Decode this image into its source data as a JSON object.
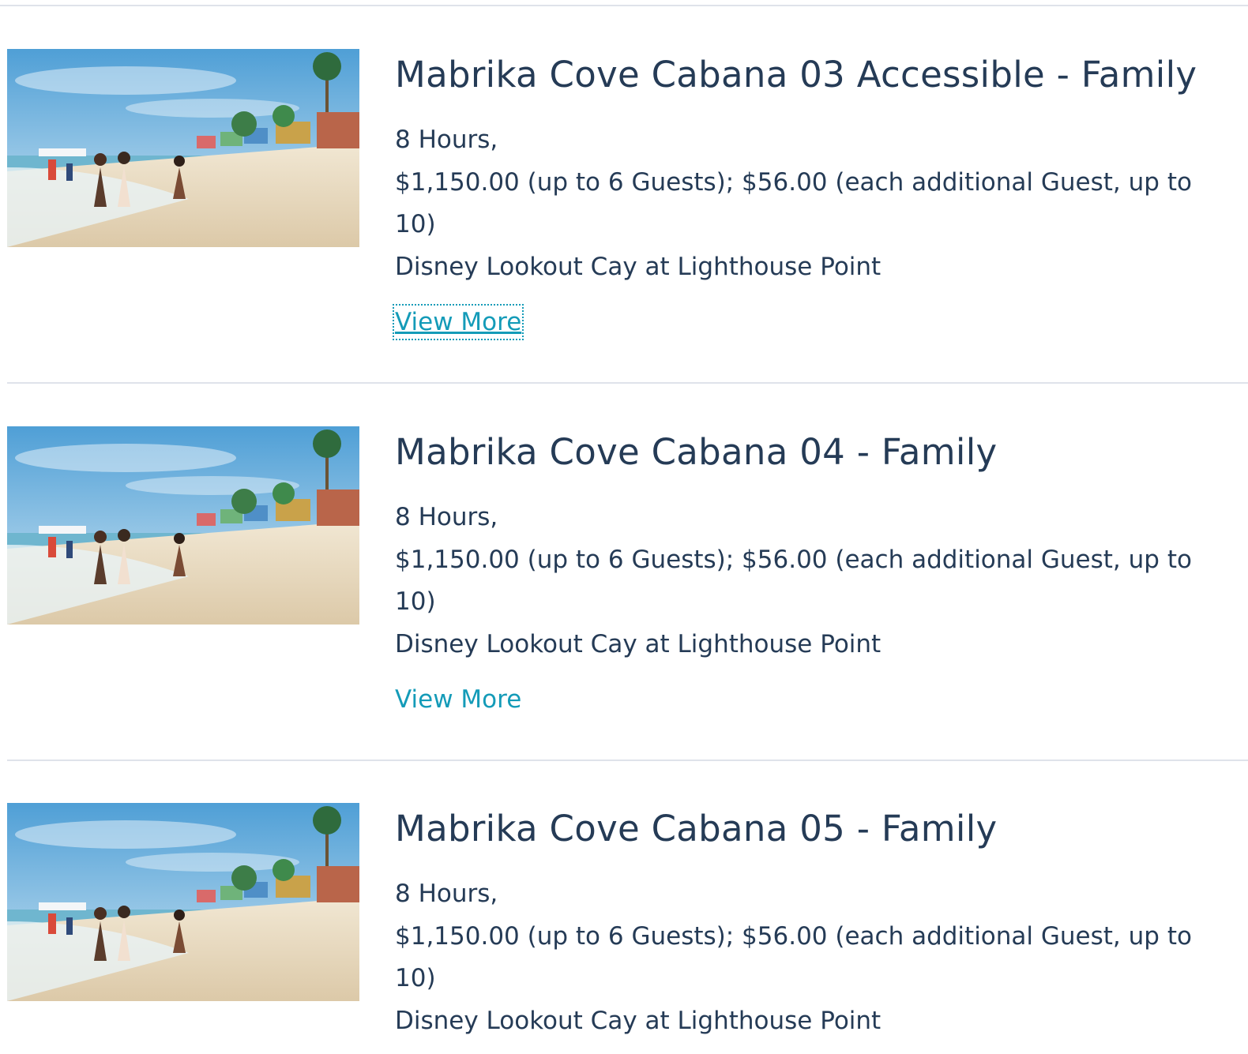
{
  "colors": {
    "title": "#253b56",
    "body_text": "#253b56",
    "link": "#149bb8",
    "divider": "#dfe3ea"
  },
  "cards": [
    {
      "image_icon": "beach-scene-image",
      "title": "Mabrika Cove Cabana 03 Accessible - Family",
      "duration": "8 Hours,",
      "price": "$1,150.00 (up to 6 Guests); $56.00 (each additional Guest, up to 10)",
      "location": "Disney Lookout Cay at Lighthouse Point",
      "link_label": "View More",
      "link_focused": true
    },
    {
      "image_icon": "beach-scene-image",
      "title": "Mabrika Cove Cabana 04 - Family",
      "duration": "8 Hours,",
      "price": "$1,150.00 (up to 6 Guests); $56.00 (each additional Guest, up to 10)",
      "location": "Disney Lookout Cay at Lighthouse Point",
      "link_label": "View More",
      "link_focused": false
    },
    {
      "image_icon": "beach-scene-image",
      "title": "Mabrika Cove Cabana 05 - Family",
      "duration": "8 Hours,",
      "price": "$1,150.00 (up to 6 Guests); $56.00 (each additional Guest, up to 10)",
      "location": "Disney Lookout Cay at Lighthouse Point",
      "link_label": "",
      "link_focused": false
    }
  ]
}
